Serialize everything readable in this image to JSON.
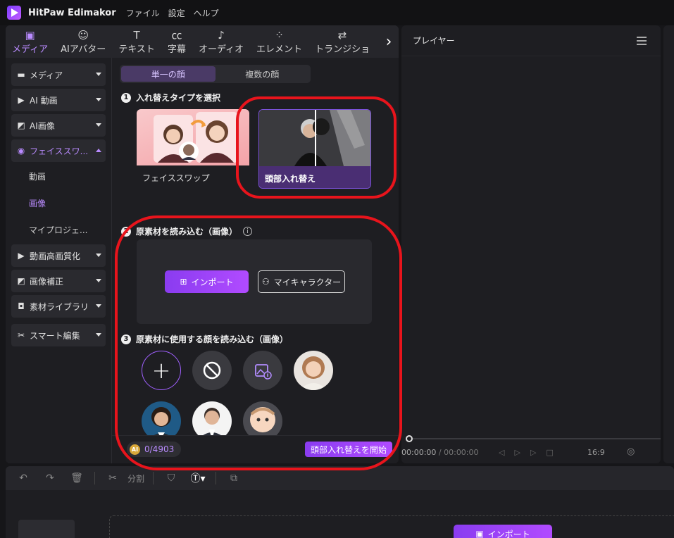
{
  "app": {
    "title": "HitPaw Edimakor",
    "menu": [
      "ファイル",
      "設定",
      "ヘルプ"
    ]
  },
  "top_tabs": [
    {
      "label": "メディア",
      "icon": "media-icon",
      "active": true
    },
    {
      "label": "AIアバター",
      "icon": "ai-avatar-icon",
      "active": false
    },
    {
      "label": "テキスト",
      "icon": "text-icon",
      "active": false
    },
    {
      "label": "字幕",
      "icon": "subtitle-icon",
      "active": false
    },
    {
      "label": "オーディオ",
      "icon": "audio-icon",
      "active": false
    },
    {
      "label": "エレメント",
      "icon": "element-icon",
      "active": false
    },
    {
      "label": "トランジショ",
      "icon": "transition-icon",
      "active": false
    }
  ],
  "sidebar": {
    "items": [
      {
        "label": "メディア",
        "icon": "folder-icon"
      },
      {
        "label": "AI 動画",
        "icon": "ai-video-icon"
      },
      {
        "label": "AI画像",
        "icon": "ai-image-icon"
      },
      {
        "label": "フェイススワ...",
        "icon": "face-swap-icon",
        "open": true
      },
      {
        "label": "動画高画質化",
        "icon": "video-enhance-icon"
      },
      {
        "label": "画像補正",
        "icon": "image-enhance-icon"
      },
      {
        "label": "素材ライブラリ",
        "icon": "library-icon"
      },
      {
        "label": "スマート編集",
        "icon": "smart-edit-icon"
      }
    ],
    "sub_items": [
      {
        "label": "動画",
        "active": false
      },
      {
        "label": "画像",
        "active": true
      },
      {
        "label": "マイプロジェ...",
        "active": false
      }
    ]
  },
  "face_swap": {
    "segments": [
      "単一の顔",
      "複数の顔"
    ],
    "step1": {
      "num": "1",
      "title": "入れ替えタイプを選択"
    },
    "cards": [
      {
        "label": "フェイススワップ",
        "selected": false
      },
      {
        "label": "頭部入れ替え",
        "selected": true
      }
    ],
    "step2": {
      "num": "2",
      "title": "原素材を読み込む（画像）",
      "info": "i"
    },
    "import_label": "インポート",
    "mychar_label": "マイキャラクター",
    "step3": {
      "num": "3",
      "title": "原素材に使用する顔を読み込む（画像）"
    },
    "faces": [
      "add-face",
      "no-face",
      "upload-face",
      "woman-face",
      "businesswoman-face",
      "businessman-face",
      "baby-face"
    ],
    "credits": {
      "badge": "AI",
      "value": "0/4903"
    },
    "start_label": "頭部入れ替えを開始"
  },
  "player": {
    "title": "プレイヤー",
    "time_current": "00:00:00",
    "time_sep": " / ",
    "time_total": "00:00:00",
    "ratio": "16:9"
  },
  "timeline": {
    "split_label": "分割",
    "import_label": "インポート"
  },
  "colors": {
    "accent": "#b98bff",
    "annotation": "#e8141c"
  }
}
